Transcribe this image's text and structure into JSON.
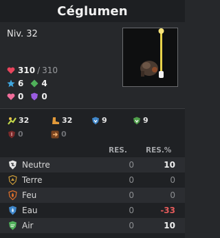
{
  "title": "Céglumen",
  "level": "Niv. 32",
  "vitals": {
    "hp_current": "310",
    "hp_separator": "/",
    "hp_max": "310",
    "ap": "6",
    "mp": "4",
    "shield": "0",
    "dodge": "0"
  },
  "secondary": {
    "row1": [
      "32",
      "32",
      "9",
      "9"
    ],
    "row2": [
      "0",
      "0"
    ]
  },
  "resistances": {
    "col_res": "RES.",
    "col_res_pct": "RES.%",
    "rows": [
      {
        "name": "Neutre",
        "res": "0",
        "pct": "10"
      },
      {
        "name": "Terre",
        "res": "0",
        "pct": "0"
      },
      {
        "name": "Feu",
        "res": "0",
        "pct": "0"
      },
      {
        "name": "Eau",
        "res": "0",
        "pct": "-33"
      },
      {
        "name": "Air",
        "res": "0",
        "pct": "10"
      }
    ]
  },
  "colors": {
    "hp": "#e8455c",
    "ap": "#3fa7e0",
    "mp": "#4fb05a",
    "negative": "#e35b5b"
  }
}
